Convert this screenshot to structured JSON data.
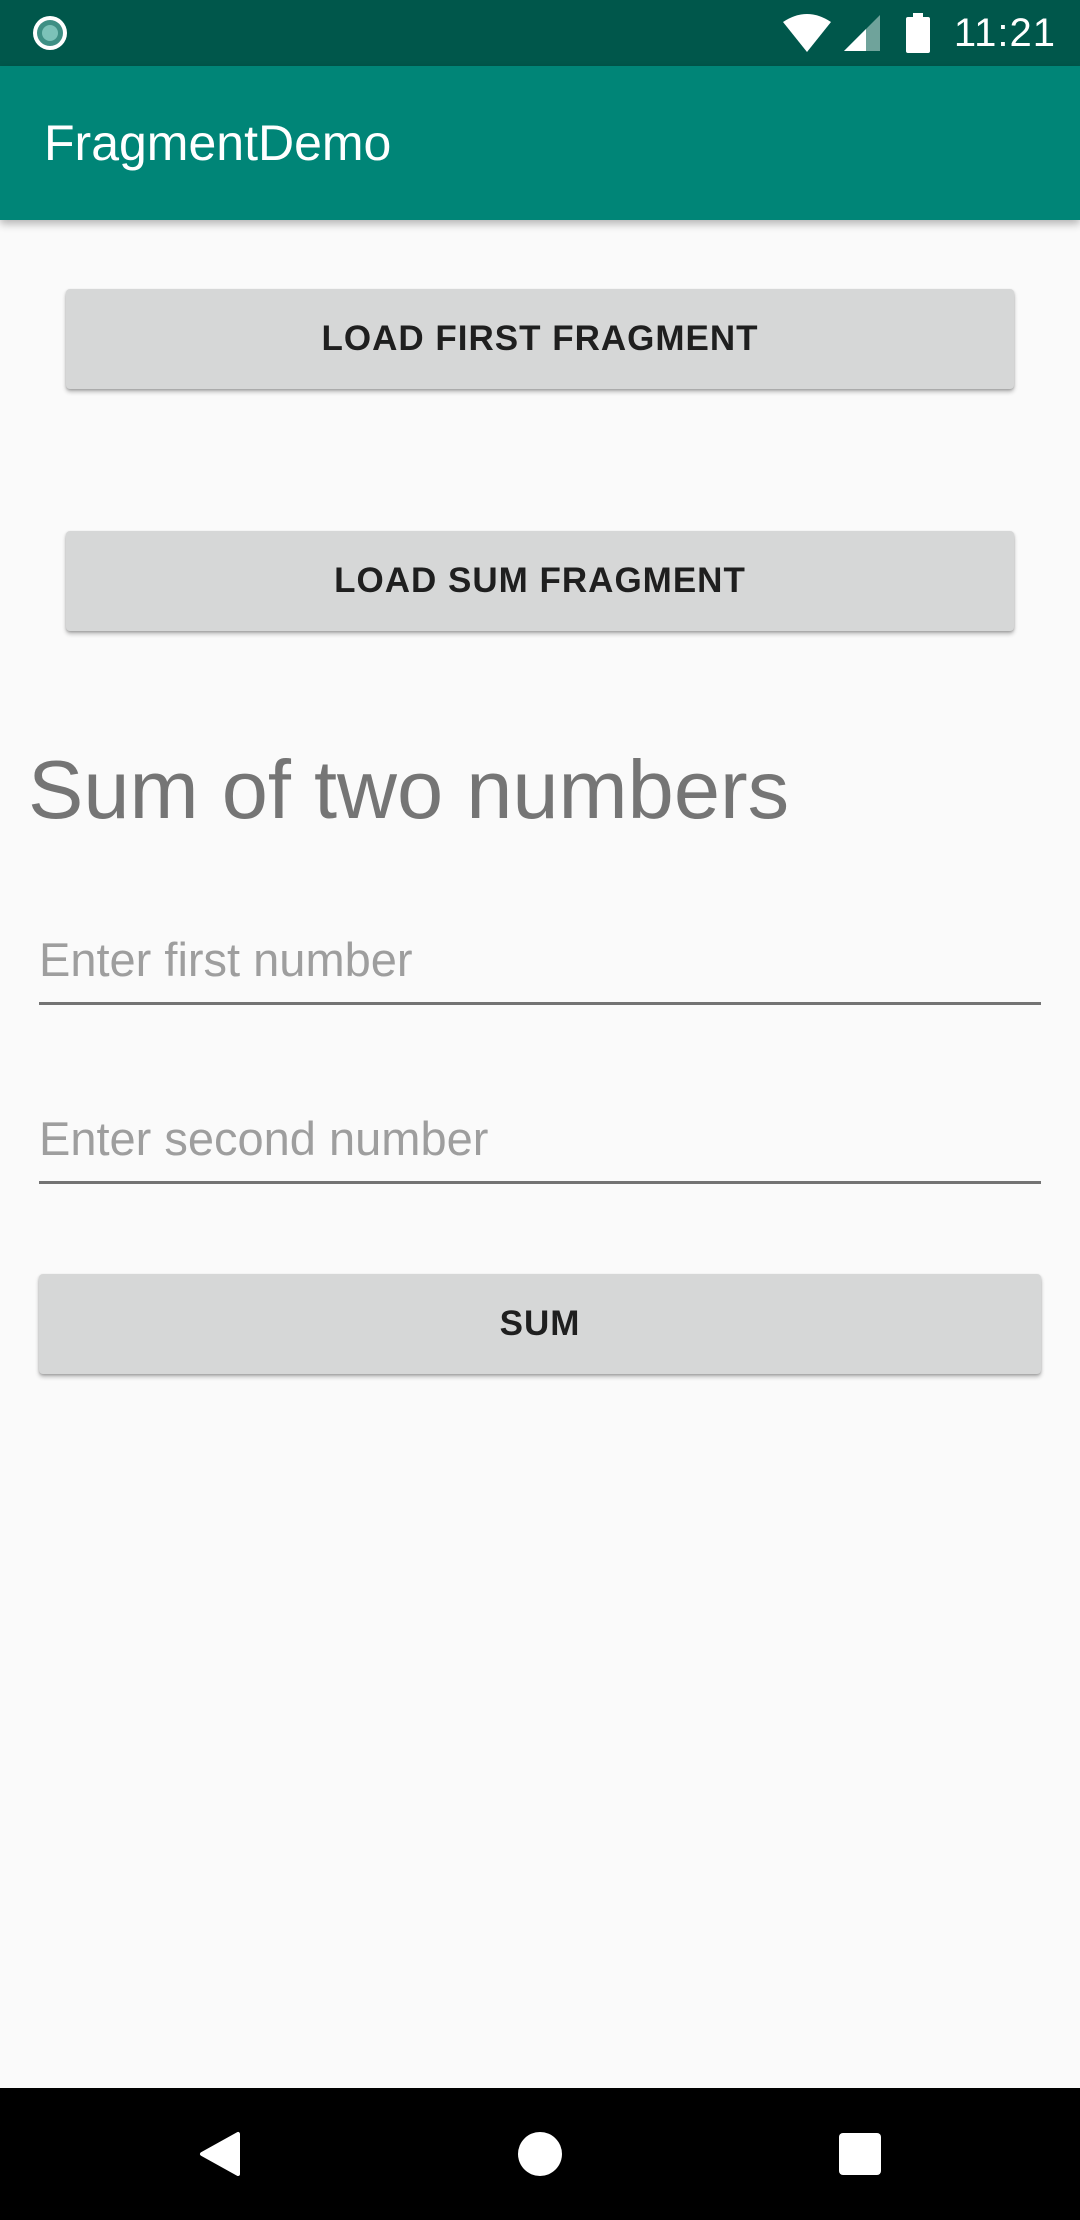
{
  "status_bar": {
    "time": "11:21",
    "icons": [
      "notification-dot-icon",
      "wifi-icon",
      "signal-icon",
      "battery-icon"
    ],
    "background": "#00574b"
  },
  "app_bar": {
    "title": "FragmentDemo",
    "background": "#008577"
  },
  "buttons": {
    "load_first": "LOAD FIRST FRAGMENT",
    "load_sum": "LOAD SUM FRAGMENT"
  },
  "sum_fragment": {
    "title": "Sum of two numbers",
    "first_input": {
      "placeholder": "Enter first number",
      "value": ""
    },
    "second_input": {
      "placeholder": "Enter second number",
      "value": ""
    },
    "sum_button": "SUM"
  },
  "nav_bar": {
    "icons": [
      "back-icon",
      "home-icon",
      "recents-icon"
    ]
  }
}
